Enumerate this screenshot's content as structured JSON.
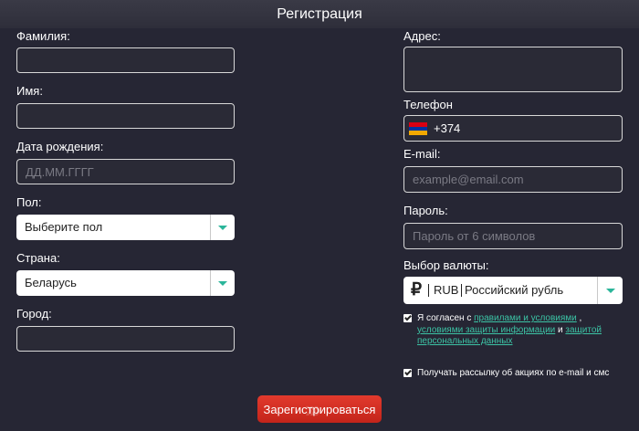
{
  "header": {
    "title": "Регистрация"
  },
  "form": {
    "surname": {
      "label": "Фамилия:",
      "value": "",
      "placeholder": ""
    },
    "name": {
      "label": "Имя:",
      "value": "",
      "placeholder": ""
    },
    "birthdate": {
      "label": "Дата рождения:",
      "placeholder": "ДД.ММ.ГГГГ"
    },
    "gender": {
      "label": "Пол:",
      "selected": "Выберите пол"
    },
    "country": {
      "label": "Страна:",
      "selected": "Беларусь"
    },
    "city": {
      "label": "Город:",
      "value": ""
    },
    "address": {
      "label": "Адрес:",
      "value": ""
    },
    "phone": {
      "label": "Телефон",
      "code": "+374",
      "flag_colors": [
        "#d90012",
        "#0033a0",
        "#f2a800"
      ]
    },
    "email": {
      "label": "E-mail:",
      "placeholder": "example@email.com"
    },
    "password": {
      "label": "Пароль:",
      "placeholder": "Пароль от 6 символов"
    },
    "currency": {
      "label": "Выбор валюты:",
      "symbol": "₽",
      "code": "RUB",
      "name": "Российский рубль"
    },
    "agree": {
      "checked": true,
      "text_before": "Я согласен с ",
      "link_terms": "правилами и условиями",
      "comma": " , ",
      "link_privacy": "условиями защиты информации",
      "and": " и ",
      "link_personal": "защитой персональных данных"
    },
    "newsletter": {
      "checked": true,
      "text": "Получать рассылку об акциях по e-mail и смс"
    },
    "submit_label": "Зарегистрироваться"
  },
  "colors": {
    "background": "#262634",
    "accent_link": "#3cc3a5",
    "dropdown_arrow": "#2bb59a",
    "submit_button": "#d42f23"
  }
}
